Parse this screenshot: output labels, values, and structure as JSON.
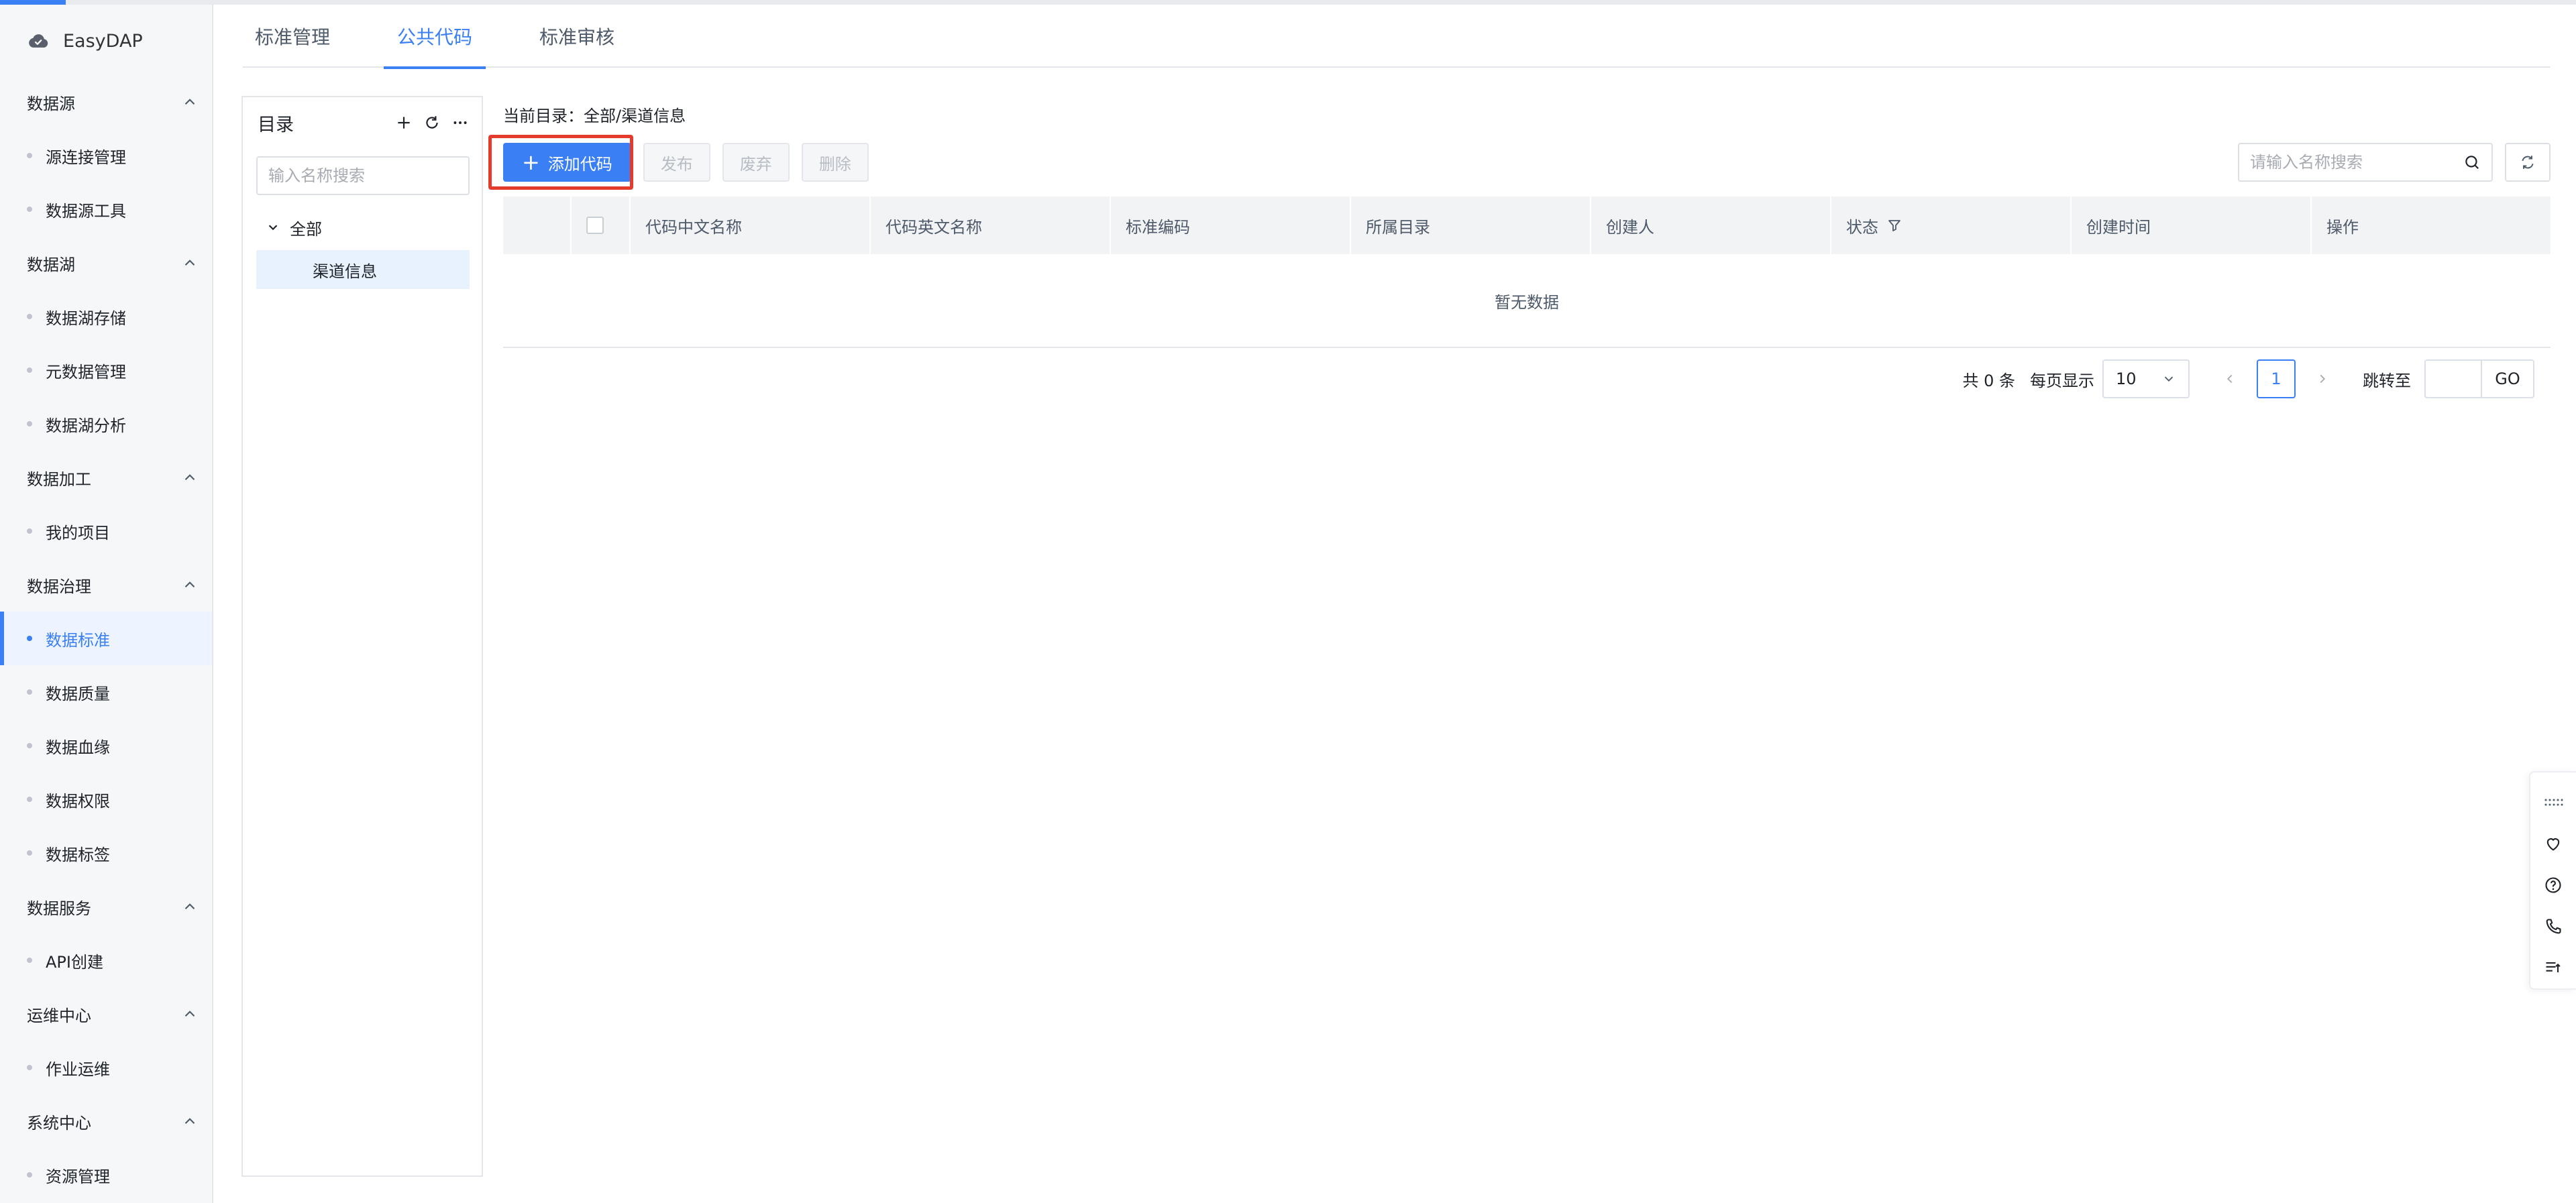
{
  "app": {
    "name": "EasyDAP"
  },
  "colors": {
    "primary": "#3b7ff5",
    "highlight": "#e53b2c"
  },
  "sidebar": {
    "groups": [
      {
        "title": "数据源",
        "items": [
          {
            "label": "源连接管理"
          },
          {
            "label": "数据源工具"
          }
        ]
      },
      {
        "title": "数据湖",
        "items": [
          {
            "label": "数据湖存储"
          },
          {
            "label": "元数据管理"
          },
          {
            "label": "数据湖分析"
          }
        ]
      },
      {
        "title": "数据加工",
        "items": [
          {
            "label": "我的项目"
          }
        ]
      },
      {
        "title": "数据治理",
        "items": [
          {
            "label": "数据标准",
            "active": true
          },
          {
            "label": "数据质量"
          },
          {
            "label": "数据血缘"
          },
          {
            "label": "数据权限"
          },
          {
            "label": "数据标签"
          }
        ]
      },
      {
        "title": "数据服务",
        "items": [
          {
            "label": "API创建"
          }
        ]
      },
      {
        "title": "运维中心",
        "items": [
          {
            "label": "作业运维"
          }
        ]
      },
      {
        "title": "系统中心",
        "items": [
          {
            "label": "资源管理"
          }
        ]
      }
    ]
  },
  "tabs": [
    {
      "label": "标准管理"
    },
    {
      "label": "公共代码",
      "active": true
    },
    {
      "label": "标准审核"
    }
  ],
  "directory": {
    "title": "目录",
    "search_placeholder": "输入名称搜索",
    "root_label": "全部",
    "child_label": "渠道信息"
  },
  "main": {
    "breadcrumb_label": "当前目录：",
    "breadcrumb_path": "全部/渠道信息",
    "buttons": {
      "add": "添加代码",
      "publish": "发布",
      "abandon": "废弃",
      "delete": "删除"
    },
    "search_placeholder": "请输入名称搜索"
  },
  "table": {
    "columns": [
      "代码中文名称",
      "代码英文名称",
      "标准编码",
      "所属目录",
      "创建人",
      "状态",
      "创建时间",
      "操作"
    ],
    "empty_text": "暂无数据"
  },
  "pagination": {
    "total": "共 0 条",
    "page_size_label": "每页显示",
    "page_size": "10",
    "current_page": "1",
    "jump_label": "跳转至",
    "go_label": "GO"
  },
  "float_toolbar": {
    "icons": [
      "grip-icon",
      "favorite-icon",
      "help-icon",
      "phone-icon",
      "list-icon"
    ]
  }
}
